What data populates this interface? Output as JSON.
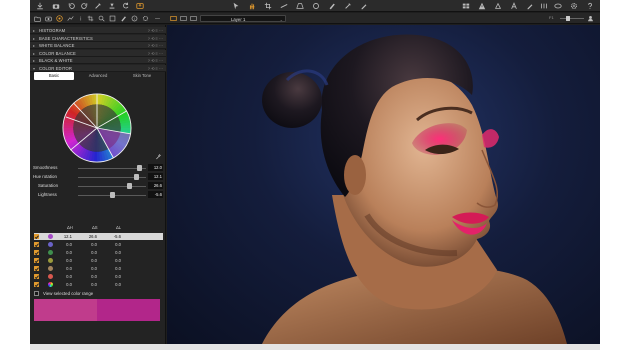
{
  "toolbar": {
    "left_icons": [
      "import-icon",
      "capture-icon",
      "undo-icon",
      "redo-icon",
      "copy-adjustments-icon",
      "reset-icon",
      "rotate-icon",
      "export-icon"
    ],
    "center_icons": [
      "select-tool-icon",
      "pan-tool-icon",
      "crop-tool-icon",
      "straighten-tool-icon",
      "keystone-tool-icon",
      "spot-removal-icon",
      "mask-brush-icon",
      "color-picker-tool-icon",
      "annotate-icon"
    ],
    "right_icons": [
      "grid-view-icon",
      "warning-icon",
      "zoom-icon",
      "text-icon",
      "edit-icon",
      "compare-icon",
      "share-icon",
      "settings-icon",
      "help-icon"
    ]
  },
  "toolrow": {
    "layer_name": "Layer 1",
    "tool_tabs": [
      "library-tab-icon",
      "capture-tab-icon",
      "color-tab-icon",
      "exposure-tab-icon",
      "lens-tab-icon",
      "composition-tab-icon",
      "details-tab-icon",
      "local-adjust-tab-icon",
      "metadata-tab-icon",
      "output-tab-icon",
      "batch-tab-icon"
    ]
  },
  "panel": {
    "sections": [
      {
        "label": "HISTOGRAM",
        "expanded": false
      },
      {
        "label": "BASE CHARACTERISTICS",
        "expanded": false
      },
      {
        "label": "WHITE BALANCE",
        "expanded": false
      },
      {
        "label": "COLOR BALANCE",
        "expanded": false
      },
      {
        "label": "BLACK & WHITE",
        "expanded": false
      },
      {
        "label": "COLOR EDITOR",
        "expanded": true
      }
    ],
    "tabs": [
      "Basic",
      "Advanced",
      "Skin Tone"
    ],
    "active_tab": "Basic",
    "sliders": [
      {
        "label": "Smoothness",
        "value": "12.0",
        "level": 0.92
      },
      {
        "label": "Hue rotation",
        "value": "12.1",
        "level": 0.88
      },
      {
        "label": "Saturation",
        "value": "26.6",
        "level": 0.77
      },
      {
        "label": "Lightness",
        "value": "-5.6",
        "level": 0.52
      }
    ],
    "table": {
      "headers": [
        "ΔH",
        "ΔS",
        "ΔL"
      ],
      "rows": [
        {
          "color": "#a54bc6",
          "dh": "12.1",
          "ds": "26.6",
          "dl": "-5.6",
          "selected": true
        },
        {
          "color": "#6a62c8",
          "dh": "0.0",
          "ds": "0.0",
          "dl": "0.0"
        },
        {
          "color": "#3f8f4e",
          "dh": "0.0",
          "ds": "0.0",
          "dl": "0.0"
        },
        {
          "color": "#9a9a3c",
          "dh": "0.0",
          "ds": "0.0",
          "dl": "0.0"
        },
        {
          "color": "#a3845e",
          "dh": "0.0",
          "ds": "0.0",
          "dl": "0.0"
        },
        {
          "color": "#d8584f",
          "dh": "0.0",
          "ds": "0.0",
          "dl": "0.0"
        },
        {
          "color": "rainbow",
          "dh": "0.0",
          "ds": "0.0",
          "dl": "0.0"
        }
      ]
    },
    "view_range_label": "View selected color range",
    "swatch_colors": [
      "#c03c8c",
      "#b2268a"
    ]
  }
}
